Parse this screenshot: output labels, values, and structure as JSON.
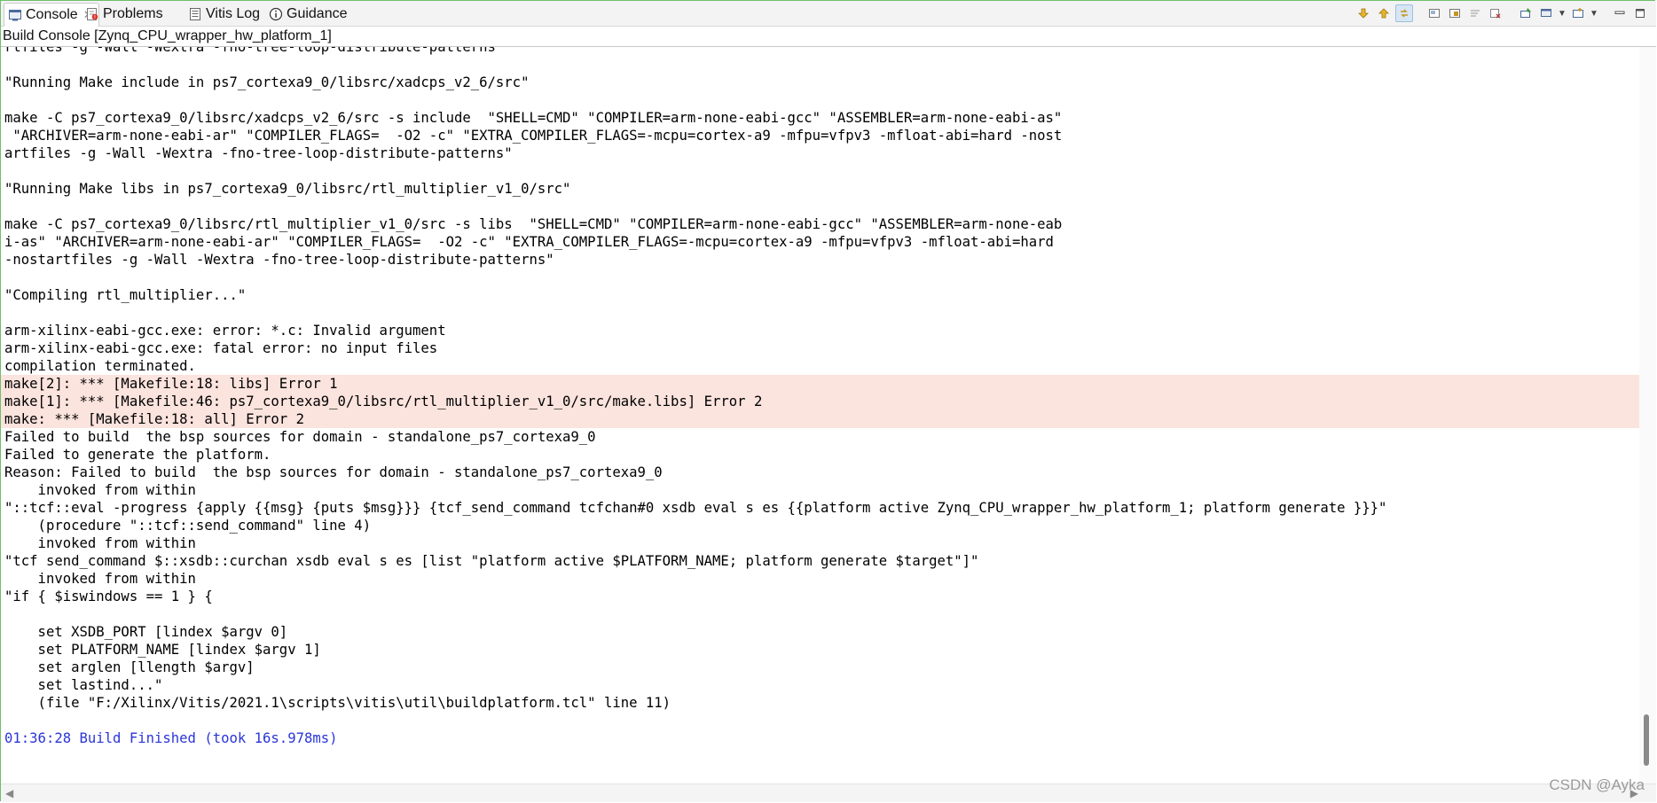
{
  "tabs": [
    {
      "label": "Console",
      "icon": "console-icon",
      "active": true,
      "close": "✕"
    },
    {
      "label": "Problems",
      "icon": "problems-icon"
    },
    {
      "label": "Vitis Log",
      "icon": "log-icon"
    },
    {
      "label": "Guidance",
      "icon": "info-icon"
    }
  ],
  "toolbar_icons": [
    "arrow-down-icon",
    "arrow-up-icon",
    "link-icon",
    "clear-console-icon",
    "scroll-lock-icon",
    "word-wrap-icon",
    "remove-launch-icon",
    "pin-console-icon",
    "display-console-icon",
    "open-console-icon",
    "minimize-icon",
    "maximize-icon"
  ],
  "console_title": "Build Console [Zynq_CPU_wrapper_hw_platform_1]",
  "output_lines": [
    {
      "text": "rtfiles -g -Wall -Wextra -fno-tree-loop-distribute-patterns",
      "kind": "normal"
    },
    {
      "text": "",
      "kind": "normal"
    },
    {
      "text": "\"Running Make include in ps7_cortexa9_0/libsrc/xadcps_v2_6/src\"",
      "kind": "normal"
    },
    {
      "text": "",
      "kind": "normal"
    },
    {
      "text": "make -C ps7_cortexa9_0/libsrc/xadcps_v2_6/src -s include  \"SHELL=CMD\" \"COMPILER=arm-none-eabi-gcc\" \"ASSEMBLER=arm-none-eabi-as\"",
      "kind": "normal"
    },
    {
      "text": " \"ARCHIVER=arm-none-eabi-ar\" \"COMPILER_FLAGS=  -O2 -c\" \"EXTRA_COMPILER_FLAGS=-mcpu=cortex-a9 -mfpu=vfpv3 -mfloat-abi=hard -nost",
      "kind": "normal"
    },
    {
      "text": "artfiles -g -Wall -Wextra -fno-tree-loop-distribute-patterns\"",
      "kind": "normal"
    },
    {
      "text": "",
      "kind": "normal"
    },
    {
      "text": "\"Running Make libs in ps7_cortexa9_0/libsrc/rtl_multiplier_v1_0/src\"",
      "kind": "normal"
    },
    {
      "text": "",
      "kind": "normal"
    },
    {
      "text": "make -C ps7_cortexa9_0/libsrc/rtl_multiplier_v1_0/src -s libs  \"SHELL=CMD\" \"COMPILER=arm-none-eabi-gcc\" \"ASSEMBLER=arm-none-eab",
      "kind": "normal"
    },
    {
      "text": "i-as\" \"ARCHIVER=arm-none-eabi-ar\" \"COMPILER_FLAGS=  -O2 -c\" \"EXTRA_COMPILER_FLAGS=-mcpu=cortex-a9 -mfpu=vfpv3 -mfloat-abi=hard",
      "kind": "normal"
    },
    {
      "text": "-nostartfiles -g -Wall -Wextra -fno-tree-loop-distribute-patterns\"",
      "kind": "normal"
    },
    {
      "text": "",
      "kind": "normal"
    },
    {
      "text": "\"Compiling rtl_multiplier...\"",
      "kind": "normal"
    },
    {
      "text": "",
      "kind": "normal"
    },
    {
      "text": "arm-xilinx-eabi-gcc.exe: error: *.c: Invalid argument",
      "kind": "normal"
    },
    {
      "text": "arm-xilinx-eabi-gcc.exe: fatal error: no input files",
      "kind": "normal"
    },
    {
      "text": "compilation terminated.",
      "kind": "normal"
    },
    {
      "text": "make[2]: *** [Makefile:18: libs] Error 1",
      "kind": "error"
    },
    {
      "text": "make[1]: *** [Makefile:46: ps7_cortexa9_0/libsrc/rtl_multiplier_v1_0/src/make.libs] Error 2",
      "kind": "error"
    },
    {
      "text": "make: *** [Makefile:18: all] Error 2",
      "kind": "error"
    },
    {
      "text": "Failed to build  the bsp sources for domain - standalone_ps7_cortexa9_0",
      "kind": "normal"
    },
    {
      "text": "Failed to generate the platform.",
      "kind": "normal"
    },
    {
      "text": "Reason: Failed to build  the bsp sources for domain - standalone_ps7_cortexa9_0",
      "kind": "normal"
    },
    {
      "text": "    invoked from within",
      "kind": "normal"
    },
    {
      "text": "\"::tcf::eval -progress {apply {{msg} {puts $msg}}} {tcf_send_command tcfchan#0 xsdb eval s es {{platform active Zynq_CPU_wrapper_hw_platform_1; platform generate }}}\"",
      "kind": "normal"
    },
    {
      "text": "    (procedure \"::tcf::send_command\" line 4)",
      "kind": "normal"
    },
    {
      "text": "    invoked from within",
      "kind": "normal"
    },
    {
      "text": "\"tcf send_command $::xsdb::curchan xsdb eval s es [list \"platform active $PLATFORM_NAME; platform generate $target\"]\"",
      "kind": "normal"
    },
    {
      "text": "    invoked from within",
      "kind": "normal"
    },
    {
      "text": "\"if { $iswindows == 1 } {",
      "kind": "normal"
    },
    {
      "text": "",
      "kind": "normal"
    },
    {
      "text": "    set XSDB_PORT [lindex $argv 0]",
      "kind": "normal"
    },
    {
      "text": "    set PLATFORM_NAME [lindex $argv 1]",
      "kind": "normal"
    },
    {
      "text": "    set arglen [llength $argv]",
      "kind": "normal"
    },
    {
      "text": "    set lastind...\"",
      "kind": "normal"
    },
    {
      "text": "    (file \"F:/Xilinx/Vitis/2021.1\\scripts\\vitis\\util\\buildplatform.tcl\" line 11)",
      "kind": "normal"
    },
    {
      "text": "",
      "kind": "normal"
    },
    {
      "text": "01:36:28 Build Finished (took 16s.978ms)",
      "kind": "ok"
    }
  ],
  "watermark": "CSDN @Ayka",
  "colors": {
    "error_bg": "#fbe3de",
    "finished_text": "#2a35d8",
    "frame_border": "#6dbf6d"
  }
}
